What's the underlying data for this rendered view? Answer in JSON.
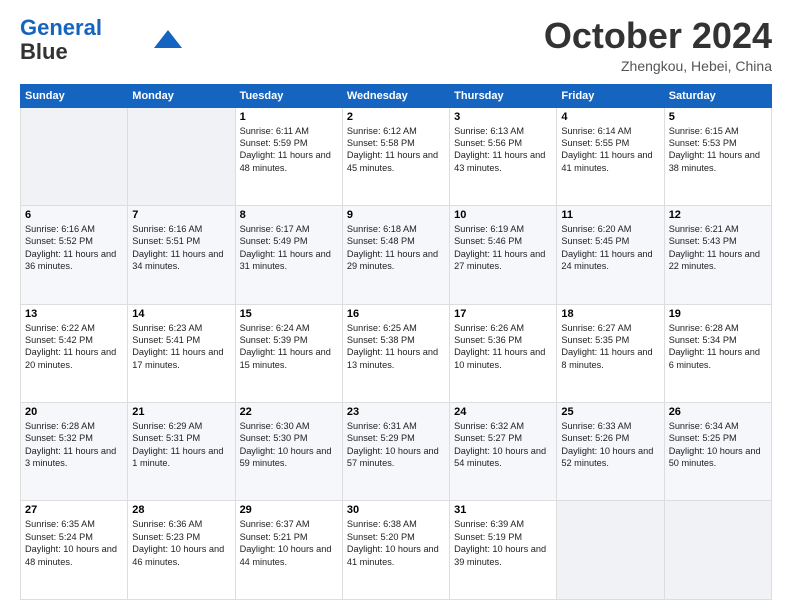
{
  "header": {
    "title": "October 2024",
    "location": "Zhengkou, Hebei, China"
  },
  "days": [
    "Sunday",
    "Monday",
    "Tuesday",
    "Wednesday",
    "Thursday",
    "Friday",
    "Saturday"
  ],
  "weeks": [
    [
      {
        "num": "",
        "info": ""
      },
      {
        "num": "",
        "info": ""
      },
      {
        "num": "1",
        "info": "Sunrise: 6:11 AM\nSunset: 5:59 PM\nDaylight: 11 hours and 48 minutes."
      },
      {
        "num": "2",
        "info": "Sunrise: 6:12 AM\nSunset: 5:58 PM\nDaylight: 11 hours and 45 minutes."
      },
      {
        "num": "3",
        "info": "Sunrise: 6:13 AM\nSunset: 5:56 PM\nDaylight: 11 hours and 43 minutes."
      },
      {
        "num": "4",
        "info": "Sunrise: 6:14 AM\nSunset: 5:55 PM\nDaylight: 11 hours and 41 minutes."
      },
      {
        "num": "5",
        "info": "Sunrise: 6:15 AM\nSunset: 5:53 PM\nDaylight: 11 hours and 38 minutes."
      }
    ],
    [
      {
        "num": "6",
        "info": "Sunrise: 6:16 AM\nSunset: 5:52 PM\nDaylight: 11 hours and 36 minutes."
      },
      {
        "num": "7",
        "info": "Sunrise: 6:16 AM\nSunset: 5:51 PM\nDaylight: 11 hours and 34 minutes."
      },
      {
        "num": "8",
        "info": "Sunrise: 6:17 AM\nSunset: 5:49 PM\nDaylight: 11 hours and 31 minutes."
      },
      {
        "num": "9",
        "info": "Sunrise: 6:18 AM\nSunset: 5:48 PM\nDaylight: 11 hours and 29 minutes."
      },
      {
        "num": "10",
        "info": "Sunrise: 6:19 AM\nSunset: 5:46 PM\nDaylight: 11 hours and 27 minutes."
      },
      {
        "num": "11",
        "info": "Sunrise: 6:20 AM\nSunset: 5:45 PM\nDaylight: 11 hours and 24 minutes."
      },
      {
        "num": "12",
        "info": "Sunrise: 6:21 AM\nSunset: 5:43 PM\nDaylight: 11 hours and 22 minutes."
      }
    ],
    [
      {
        "num": "13",
        "info": "Sunrise: 6:22 AM\nSunset: 5:42 PM\nDaylight: 11 hours and 20 minutes."
      },
      {
        "num": "14",
        "info": "Sunrise: 6:23 AM\nSunset: 5:41 PM\nDaylight: 11 hours and 17 minutes."
      },
      {
        "num": "15",
        "info": "Sunrise: 6:24 AM\nSunset: 5:39 PM\nDaylight: 11 hours and 15 minutes."
      },
      {
        "num": "16",
        "info": "Sunrise: 6:25 AM\nSunset: 5:38 PM\nDaylight: 11 hours and 13 minutes."
      },
      {
        "num": "17",
        "info": "Sunrise: 6:26 AM\nSunset: 5:36 PM\nDaylight: 11 hours and 10 minutes."
      },
      {
        "num": "18",
        "info": "Sunrise: 6:27 AM\nSunset: 5:35 PM\nDaylight: 11 hours and 8 minutes."
      },
      {
        "num": "19",
        "info": "Sunrise: 6:28 AM\nSunset: 5:34 PM\nDaylight: 11 hours and 6 minutes."
      }
    ],
    [
      {
        "num": "20",
        "info": "Sunrise: 6:28 AM\nSunset: 5:32 PM\nDaylight: 11 hours and 3 minutes."
      },
      {
        "num": "21",
        "info": "Sunrise: 6:29 AM\nSunset: 5:31 PM\nDaylight: 11 hours and 1 minute."
      },
      {
        "num": "22",
        "info": "Sunrise: 6:30 AM\nSunset: 5:30 PM\nDaylight: 10 hours and 59 minutes."
      },
      {
        "num": "23",
        "info": "Sunrise: 6:31 AM\nSunset: 5:29 PM\nDaylight: 10 hours and 57 minutes."
      },
      {
        "num": "24",
        "info": "Sunrise: 6:32 AM\nSunset: 5:27 PM\nDaylight: 10 hours and 54 minutes."
      },
      {
        "num": "25",
        "info": "Sunrise: 6:33 AM\nSunset: 5:26 PM\nDaylight: 10 hours and 52 minutes."
      },
      {
        "num": "26",
        "info": "Sunrise: 6:34 AM\nSunset: 5:25 PM\nDaylight: 10 hours and 50 minutes."
      }
    ],
    [
      {
        "num": "27",
        "info": "Sunrise: 6:35 AM\nSunset: 5:24 PM\nDaylight: 10 hours and 48 minutes."
      },
      {
        "num": "28",
        "info": "Sunrise: 6:36 AM\nSunset: 5:23 PM\nDaylight: 10 hours and 46 minutes."
      },
      {
        "num": "29",
        "info": "Sunrise: 6:37 AM\nSunset: 5:21 PM\nDaylight: 10 hours and 44 minutes."
      },
      {
        "num": "30",
        "info": "Sunrise: 6:38 AM\nSunset: 5:20 PM\nDaylight: 10 hours and 41 minutes."
      },
      {
        "num": "31",
        "info": "Sunrise: 6:39 AM\nSunset: 5:19 PM\nDaylight: 10 hours and 39 minutes."
      },
      {
        "num": "",
        "info": ""
      },
      {
        "num": "",
        "info": ""
      }
    ]
  ]
}
